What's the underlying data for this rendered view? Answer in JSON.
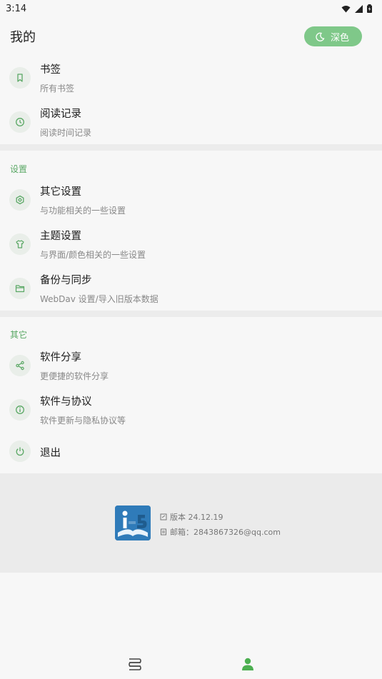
{
  "status": {
    "time": "3:14"
  },
  "header": {
    "title": "我的",
    "dark_label": "深色"
  },
  "top_items": [
    {
      "title": "书签",
      "sub": "所有书签",
      "icon": "bookmark-icon"
    },
    {
      "title": "阅读记录",
      "sub": "阅读时间记录",
      "icon": "clock-icon"
    }
  ],
  "settings": {
    "label": "设置",
    "items": [
      {
        "title": "其它设置",
        "sub": "与功能相关的一些设置",
        "icon": "settings-icon"
      },
      {
        "title": "主题设置",
        "sub": "与界面/颜色相关的一些设置",
        "icon": "shirt-icon"
      },
      {
        "title": "备份与同步",
        "sub": "WebDav 设置/导入旧版本数据",
        "icon": "folder-icon"
      }
    ]
  },
  "other": {
    "label": "其它",
    "items": [
      {
        "title": "软件分享",
        "sub": "更便捷的软件分享",
        "icon": "share-icon"
      },
      {
        "title": "软件与协议",
        "sub": "软件更新与隐私协议等",
        "icon": "info-icon"
      },
      {
        "title": "退出",
        "sub": "",
        "icon": "power-icon"
      }
    ]
  },
  "footer": {
    "version": "版本 24.12.19",
    "email": "邮箱：2843867326@qq.com"
  },
  "colors": {
    "accent": "#7fc889",
    "accent_text": "#5aa865"
  }
}
